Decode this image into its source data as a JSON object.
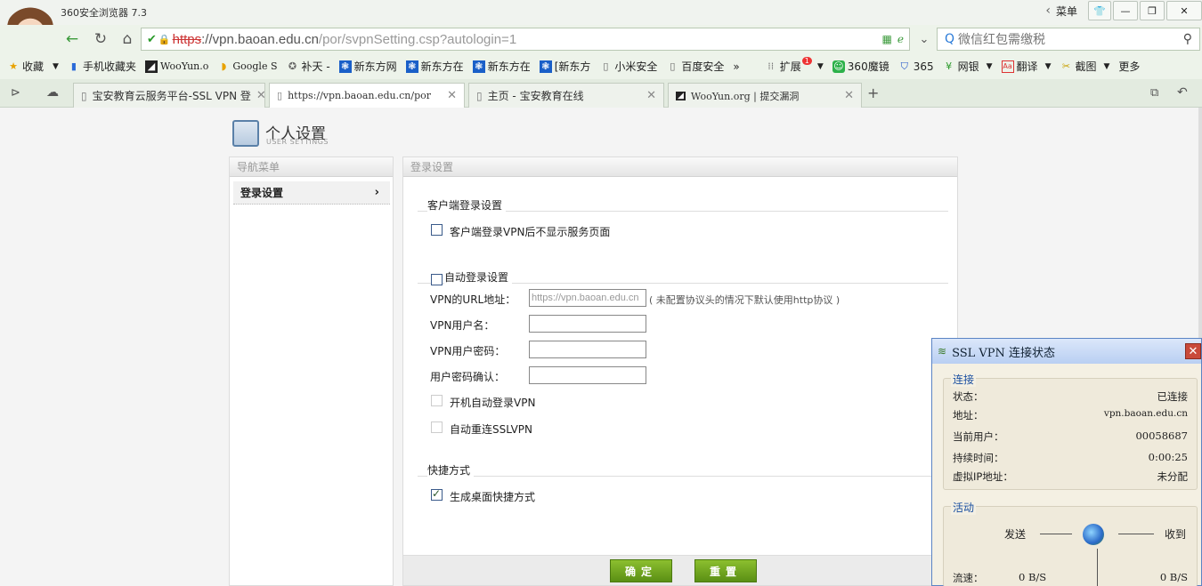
{
  "browser": {
    "title": "360安全浏览器 7.3",
    "menu_label": "菜单",
    "url_scheme": "https",
    "url_host": "://vpn.baoan.edu.cn",
    "url_path": "/por/svpnSetting.csp?autologin=1",
    "search_placeholder": "微信红包需缴税",
    "favorites": [
      {
        "label": "收藏",
        "icon": "star-icon"
      },
      {
        "label": "手机收藏夹",
        "icon": "phone-icon"
      },
      {
        "label": "WooYun.o",
        "icon": "wooyun-icon"
      },
      {
        "label": "Google S",
        "icon": "google-icon"
      },
      {
        "label": "补天 -",
        "icon": "butian-icon"
      },
      {
        "label": "新东方网",
        "icon": "paw-icon"
      },
      {
        "label": "新东方在",
        "icon": "paw-icon"
      },
      {
        "label": "新东方在",
        "icon": "paw-icon"
      },
      {
        "label": "[新东方",
        "icon": "paw-icon"
      },
      {
        "label": "小米安全",
        "icon": "page-icon"
      },
      {
        "label": "百度安全",
        "icon": "page-icon"
      }
    ],
    "extensions": [
      {
        "label": "扩展",
        "badge": "1"
      },
      {
        "label": "360魔镜"
      },
      {
        "label": "365"
      },
      {
        "label": "网银"
      },
      {
        "label": "翻译"
      },
      {
        "label": "截图"
      },
      {
        "label": "更多"
      }
    ],
    "tabs": [
      {
        "label": "宝安教育云服务平台-SSL VPN 登"
      },
      {
        "label": "https://vpn.baoan.edu.cn/por"
      },
      {
        "label": "主页 - 宝安教育在线"
      },
      {
        "label": "WooYun.org | 提交漏洞"
      }
    ]
  },
  "page": {
    "title": "个人设置",
    "subtitle": "USER SETTINGS",
    "nav_header": "导航菜单",
    "nav_item": "登录设置",
    "content_header": "登录设置",
    "client_section": "客户端登录设置",
    "client_option": "客户端登录VPN后不显示服务页面",
    "auto_section": "自动登录设置",
    "url_label": "VPN的URL地址：",
    "url_value": "https://vpn.baoan.edu.cn",
    "url_hint": "( 未配置协议头的情况下默认使用http协议 )",
    "user_label": "VPN用户名：",
    "pwd_label": "VPN用户密码：",
    "pwd_confirm_label": "用户密码确认：",
    "auto_login_label": "开机自动登录VPN",
    "auto_reconnect_label": "自动重连SSLVPN",
    "shortcut_section": "快捷方式",
    "shortcut_label": "生成桌面快捷方式",
    "ok_label": "确定",
    "reset_label": "重置"
  },
  "vpn_status": {
    "title": "SSL VPN 连接状态",
    "conn_group": "连接",
    "state_k": "状态：",
    "state_v": "已连接",
    "addr_k": "地址：",
    "addr_v": "vpn.baoan.edu.cn",
    "user_k": "当前用户：",
    "user_v": "00058687",
    "dur_k": "持续时间：",
    "dur_v": "0:00:25",
    "vip_k": "虚拟IP地址：",
    "vip_v": "未分配",
    "activity_group": "活动",
    "send": "发送",
    "recv": "收到",
    "speed_k": "流速：",
    "speed_send": "0 B/S",
    "speed_recv": "0 B/S"
  }
}
